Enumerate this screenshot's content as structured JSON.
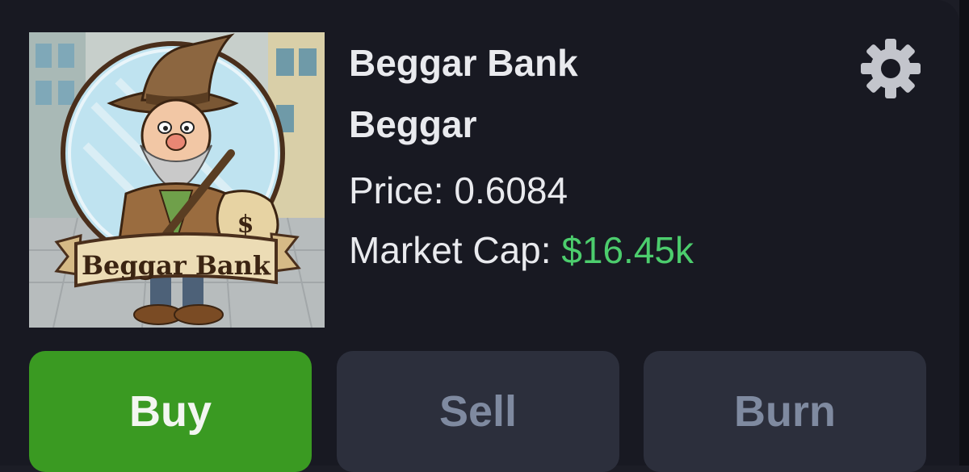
{
  "token": {
    "name": "Beggar Bank",
    "ticker": "Beggar",
    "price_label": "Price:",
    "price_value": "0.6084",
    "market_cap_label": "Market Cap:",
    "market_cap_value": "$16.45k",
    "image_banner_text": "Beggar Bank",
    "image_bag_symbol": "$"
  },
  "settings": {
    "icon": "gear-icon"
  },
  "actions": {
    "buy_label": "Buy",
    "sell_label": "Sell",
    "burn_label": "Burn"
  },
  "colors": {
    "background": "#181922",
    "buy": "#3a9a22",
    "secondary_button": "#2c2f3c",
    "market_cap_value": "#4ccd6d"
  }
}
